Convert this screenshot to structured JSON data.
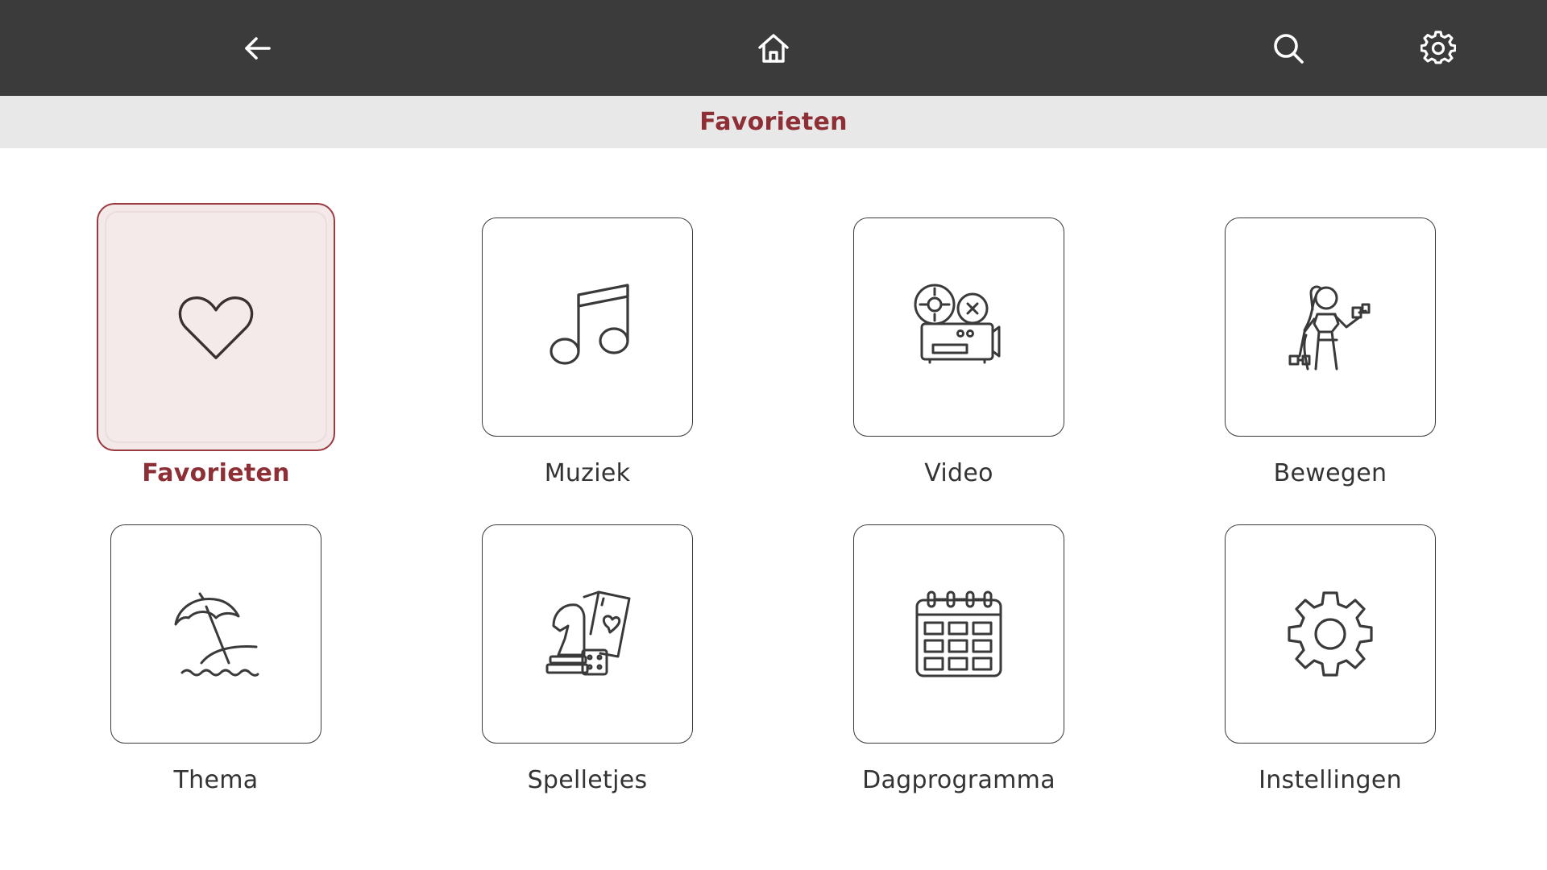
{
  "header": {
    "back_icon": "arrow-left-icon",
    "home_icon": "home-icon",
    "search_icon": "search-icon",
    "settings_icon": "gear-icon",
    "background": "#3b3b3b"
  },
  "subheader": {
    "title": "Favorieten",
    "title_color": "#8e2f35"
  },
  "tiles": [
    {
      "label": "Favorieten",
      "icon": "heart-icon",
      "selected": true
    },
    {
      "label": "Muziek",
      "icon": "music-note-icon",
      "selected": false
    },
    {
      "label": "Video",
      "icon": "film-projector-icon",
      "selected": false
    },
    {
      "label": "Bewegen",
      "icon": "exercise-icon",
      "selected": false
    },
    {
      "label": "Thema",
      "icon": "beach-umbrella-icon",
      "selected": false
    },
    {
      "label": "Spelletjes",
      "icon": "games-icon",
      "selected": false
    },
    {
      "label": "Dagprogramma",
      "icon": "calendar-icon",
      "selected": false
    },
    {
      "label": "Instellingen",
      "icon": "cog-icon",
      "selected": false
    }
  ],
  "colors": {
    "accent": "#8e2f35",
    "selected_tile_bg": "#f3e9e9"
  }
}
